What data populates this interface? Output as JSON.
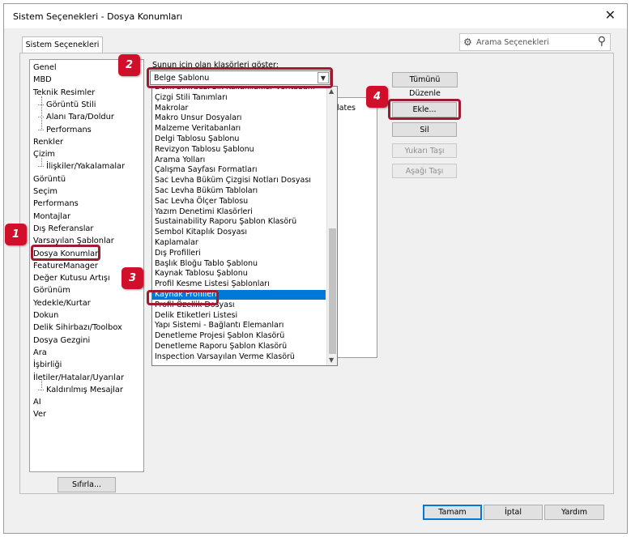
{
  "window": {
    "title": "Sistem Seçenekleri - Dosya Konumları",
    "close_glyph": "✕"
  },
  "tab": {
    "label": "Sistem Seçenekleri"
  },
  "search": {
    "placeholder": "Arama Seçenekleri"
  },
  "tree": {
    "items": [
      {
        "label": "Genel",
        "level": 0
      },
      {
        "label": "MBD",
        "level": 0
      },
      {
        "label": "Teknik Resimler",
        "level": 0
      },
      {
        "label": "Görüntü Stili",
        "level": 1
      },
      {
        "label": "Alanı Tara/Doldur",
        "level": 1
      },
      {
        "label": "Performans",
        "level": 1
      },
      {
        "label": "Renkler",
        "level": 0
      },
      {
        "label": "Çizim",
        "level": 0
      },
      {
        "label": "İlişkiler/Yakalamalar",
        "level": 1
      },
      {
        "label": "Görüntü",
        "level": 0
      },
      {
        "label": "Seçim",
        "level": 0
      },
      {
        "label": "Performans",
        "level": 0
      },
      {
        "label": "Montajlar",
        "level": 0
      },
      {
        "label": "Dış Referanslar",
        "level": 0
      },
      {
        "label": "Varsayılan Şablonlar",
        "level": 0
      },
      {
        "label": "Dosya Konumları",
        "level": 0
      },
      {
        "label": "FeatureManager",
        "level": 0
      },
      {
        "label": "Değer Kutusu Artışı",
        "level": 0
      },
      {
        "label": "Görünüm",
        "level": 0
      },
      {
        "label": "Yedekle/Kurtar",
        "level": 0
      },
      {
        "label": "Dokun",
        "level": 0
      },
      {
        "label": "Delik Sihirbazı/Toolbox",
        "level": 0
      },
      {
        "label": "Dosya Gezgini",
        "level": 0
      },
      {
        "label": "Ara",
        "level": 0
      },
      {
        "label": "İşbirliği",
        "level": 0
      },
      {
        "label": "İletiler/Hatalar/Uyarılar",
        "level": 0
      },
      {
        "label": "Kaldırılmış Mesajlar",
        "level": 1
      },
      {
        "label": "AI",
        "level": 0
      },
      {
        "label": "Ver",
        "level": 0
      }
    ],
    "reset_label": "Sıfırla..."
  },
  "folders": {
    "show_label": "Şunun için olan klasörleri göster:",
    "selected_value": "Belge Şablonu",
    "list_text": "plates"
  },
  "dropdown": {
    "options": [
      "Delik Sihirbazı Sık Kullanılanlar Veritabanı",
      "Çizgi Stili Tanımları",
      "Makrolar",
      "Makro Unsur Dosyaları",
      "Malzeme Veritabanları",
      "Delgi Tablosu Şablonu",
      "Revizyon Tablosu Şablonu",
      "Arama Yolları",
      "Çalışma Sayfası Formatları",
      "Sac Levha Büküm Çizgisi Notları Dosyası",
      "Sac Levha Büküm Tabloları",
      "Sac Levha Ölçer Tablosu",
      "Yazım Denetimi Klasörleri",
      "Sustainability Raporu Şablon Klasörü",
      "Sembol Kitaplık Dosyası",
      "Kaplamalar",
      "Dış Profilleri",
      "Başlık Bloğu Tablo Şablonu",
      "Kaynak Tablosu Şablonu",
      "Profil Kesme Listesi Şablonları",
      "Kaynak Profilleri",
      "Profil Özellik Dosyası",
      "Delik Etiketleri Listesi",
      "Yapı Sistemi - Bağlantı Elemanları",
      "Denetleme Projesi Şablon Klasörü",
      "Denetleme Raporu Şablon Klasörü",
      "Inspection Varsayılan Verme Klasörü"
    ],
    "selected_index": 20
  },
  "buttons": {
    "edit_all": "Tümünü Düzenle",
    "add": "Ekle...",
    "delete": "Sil",
    "move_up": "Yukarı Taşı",
    "move_down": "Aşağı Taşı",
    "ok": "Tamam",
    "cancel": "İptal",
    "help": "Yardım"
  },
  "callouts": [
    "1",
    "2",
    "3",
    "4"
  ],
  "icons": {
    "search": "search-icon",
    "gear": "gear-icon",
    "dropdown": "chevron-down-icon"
  },
  "colors": {
    "callout": "#d0102a",
    "highlight_border": "#9e1b32",
    "selection": "#0078d7"
  }
}
